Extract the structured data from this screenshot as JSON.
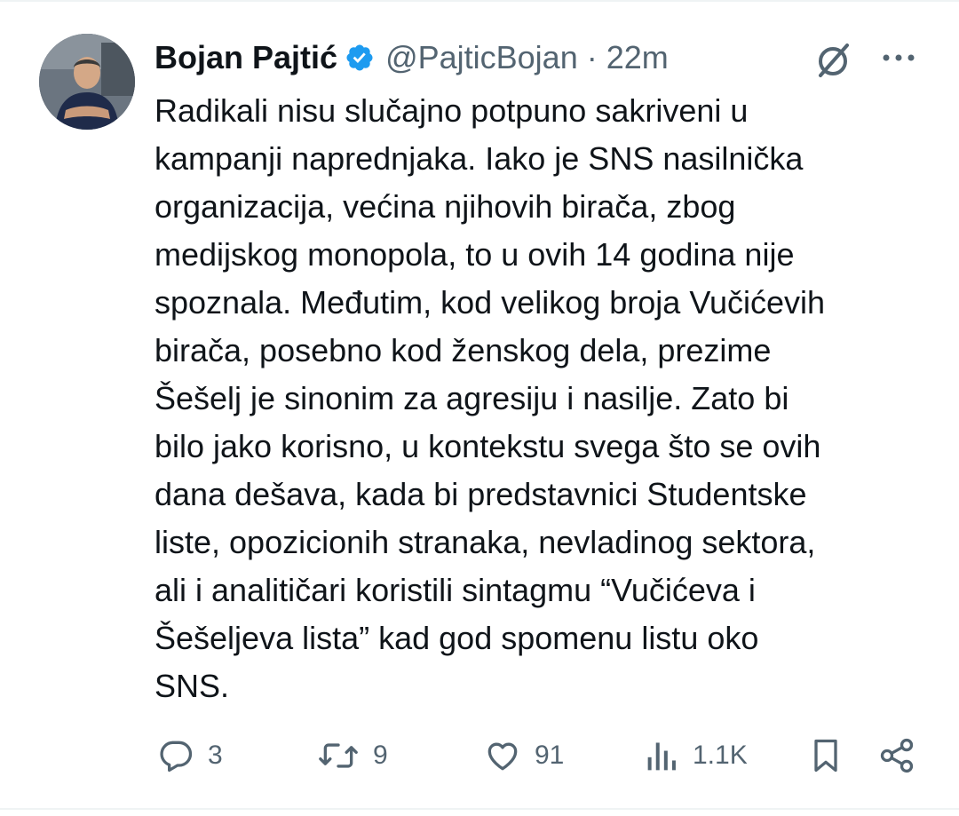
{
  "tweet": {
    "author": {
      "display_name": "Bojan Pajtić",
      "handle": "@PajticBojan",
      "verified": true,
      "verified_color": "#1d9bf0"
    },
    "separator": "·",
    "time": "22m",
    "text": "Radikali nisu slučajno potpuno sakriveni u\nkampanji naprednjaka. Iako je SNS nasilnička\norganizacija, većina njihovih birača, zbog\nmedijskog monopola, to u ovih 14 godina nije\nspoznala. Međutim, kod velikog broja Vučićevih\nbirača, posebno kod ženskog dela, prezime\nŠešelj je sinonim za agresiju i nasilje. Zato bi\nbilo jako korisno, u kontekstu svega što se ovih\ndana dešava, kada bi predstavnici Studentske\nliste, opozicionih stranaka, nevladinog sektora,\nali i analitičari koristili sintagmu “Vučićeva i\nŠešeljeva lista” kad god spomenu listu oko\nSNS."
  },
  "actions": {
    "replies": "3",
    "reposts": "9",
    "likes": "91",
    "views": "1.1K"
  },
  "icons": {
    "avatar": "profile-photo",
    "verified": "verified-badge-icon",
    "grok": "grok-icon",
    "more": "more-icon",
    "reply": "reply-icon",
    "repost": "repost-icon",
    "like": "heart-icon",
    "views": "views-icon",
    "bookmark": "bookmark-icon",
    "share": "share-icon"
  },
  "colors": {
    "text": "#0f1419",
    "secondary": "#536471",
    "accent": "#1d9bf0"
  }
}
